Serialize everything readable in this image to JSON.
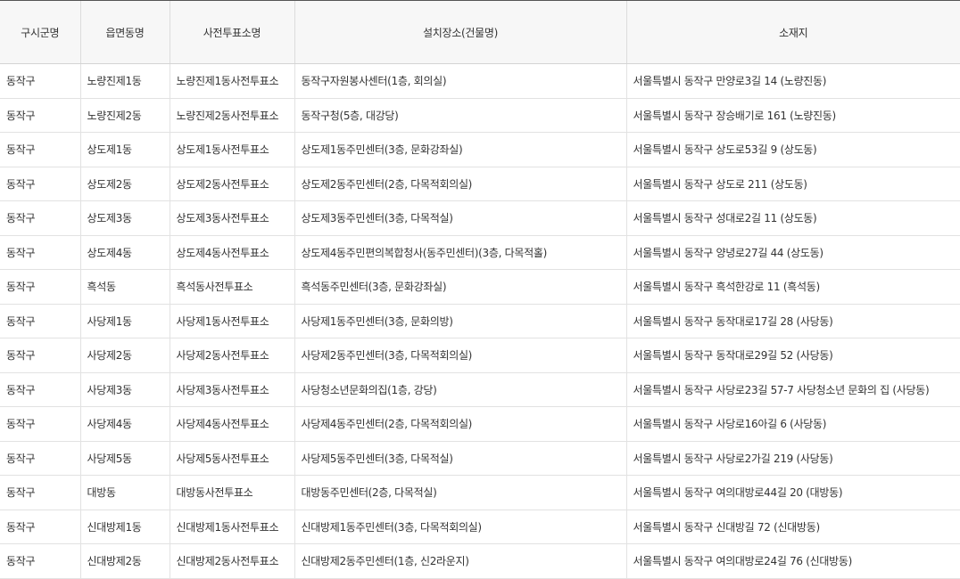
{
  "table": {
    "headers": [
      "구시군명",
      "읍면동명",
      "사전투표소명",
      "설치장소(건물명)",
      "소재지"
    ],
    "rows": [
      [
        "동작구",
        "노량진제1동",
        "노량진제1동사전투표소",
        "동작구자원봉사센터(1층, 회의실)",
        "서울특별시 동작구 만양로3길 14 (노량진동)"
      ],
      [
        "동작구",
        "노량진제2동",
        "노량진제2동사전투표소",
        "동작구청(5층, 대강당)",
        "서울특별시 동작구 장승배기로 161 (노량진동)"
      ],
      [
        "동작구",
        "상도제1동",
        "상도제1동사전투표소",
        "상도제1동주민센터(3층, 문화강좌실)",
        "서울특별시 동작구 상도로53길 9 (상도동)"
      ],
      [
        "동작구",
        "상도제2동",
        "상도제2동사전투표소",
        "상도제2동주민센터(2층, 다목적회의실)",
        "서울특별시 동작구 상도로 211 (상도동)"
      ],
      [
        "동작구",
        "상도제3동",
        "상도제3동사전투표소",
        "상도제3동주민센터(3층, 다목적실)",
        "서울특별시 동작구 성대로2길 11 (상도동)"
      ],
      [
        "동작구",
        "상도제4동",
        "상도제4동사전투표소",
        "상도제4동주민편의복합청사(동주민센터)(3층, 다목적홀)",
        "서울특별시 동작구 양녕로27길 44 (상도동)"
      ],
      [
        "동작구",
        "흑석동",
        "흑석동사전투표소",
        "흑석동주민센터(3층, 문화강좌실)",
        "서울특별시 동작구 흑석한강로 11 (흑석동)"
      ],
      [
        "동작구",
        "사당제1동",
        "사당제1동사전투표소",
        "사당제1동주민센터(3층, 문화의방)",
        "서울특별시 동작구 동작대로17길 28 (사당동)"
      ],
      [
        "동작구",
        "사당제2동",
        "사당제2동사전투표소",
        "사당제2동주민센터(3층, 다목적회의실)",
        "서울특별시 동작구 동작대로29길 52 (사당동)"
      ],
      [
        "동작구",
        "사당제3동",
        "사당제3동사전투표소",
        "사당청소년문화의집(1층, 강당)",
        "서울특별시 동작구 사당로23길 57-7 사당청소년 문화의 집 (사당동)"
      ],
      [
        "동작구",
        "사당제4동",
        "사당제4동사전투표소",
        "사당제4동주민센터(2층, 다목적회의실)",
        "서울특별시 동작구 사당로16아길 6 (사당동)"
      ],
      [
        "동작구",
        "사당제5동",
        "사당제5동사전투표소",
        "사당제5동주민센터(3층, 다목적실)",
        "서울특별시 동작구 사당로2가길 219 (사당동)"
      ],
      [
        "동작구",
        "대방동",
        "대방동사전투표소",
        "대방동주민센터(2층, 다목적실)",
        "서울특별시 동작구 여의대방로44길 20 (대방동)"
      ],
      [
        "동작구",
        "신대방제1동",
        "신대방제1동사전투표소",
        "신대방제1동주민센터(3층, 다목적회의실)",
        "서울특별시 동작구 신대방길 72 (신대방동)"
      ],
      [
        "동작구",
        "신대방제2동",
        "신대방제2동사전투표소",
        "신대방제2동주민센터(1층, 신2라운지)",
        "서울특별시 동작구 여의대방로24길 76 (신대방동)"
      ]
    ]
  }
}
